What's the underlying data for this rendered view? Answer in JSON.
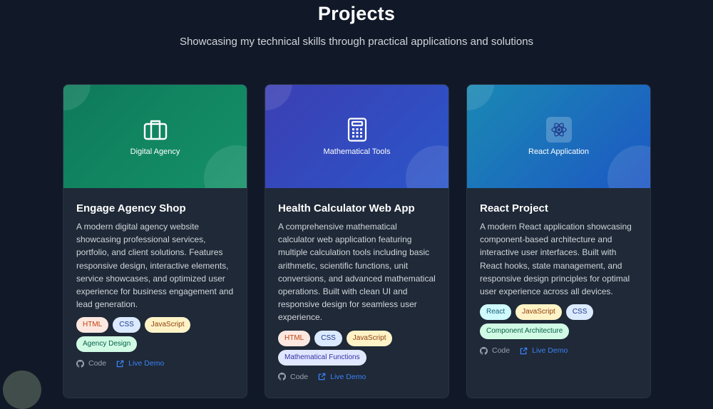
{
  "header": {
    "title": "Projects",
    "subtitle": "Showcasing my technical skills through practical applications and solutions"
  },
  "cards": [
    {
      "hero_label": "Digital Agency",
      "hero_icon": "briefcase-icon",
      "title": "Engage Agency Shop",
      "description": "A modern digital agency website showcasing professional services, portfolio, and client solutions. Features responsive design, interactive elements, service showcases, and optimized user experience for business engagement and lead generation.",
      "tags": [
        "HTML",
        "CSS",
        "JavaScript",
        "Agency Design"
      ],
      "code_label": "Code",
      "demo_label": "Live Demo"
    },
    {
      "hero_label": "Mathematical Tools",
      "hero_icon": "calculator-icon",
      "title": "Health Calculator Web App",
      "description": "A comprehensive mathematical calculator web application featuring multiple calculation tools including basic arithmetic, scientific functions, unit conversions, and advanced mathematical operations. Built with clean UI and responsive design for seamless user experience.",
      "tags": [
        "HTML",
        "CSS",
        "JavaScript",
        "Mathematical Functions"
      ],
      "code_label": "Code",
      "demo_label": "Live Demo"
    },
    {
      "hero_label": "React Application",
      "hero_icon": "react-icon",
      "title": "React Project",
      "description": "A modern React application showcasing component-based architecture and interactive user interfaces. Built with React hooks, state management, and responsive design principles for optimal user experience across all devices.",
      "tags": [
        "React",
        "JavaScript",
        "CSS",
        "Component Architecture"
      ],
      "code_label": "Code",
      "demo_label": "Live Demo"
    }
  ],
  "colors": {
    "background": "#111827",
    "card": "#1f2937",
    "hero_green": [
      "#0e7a5a",
      "#1a9a6e"
    ],
    "hero_indigo": [
      "#3b3fb3",
      "#2c55c9"
    ],
    "hero_blue": [
      "#1a86b5",
      "#1d55c6"
    ],
    "link_blue": "#3b82f6"
  }
}
